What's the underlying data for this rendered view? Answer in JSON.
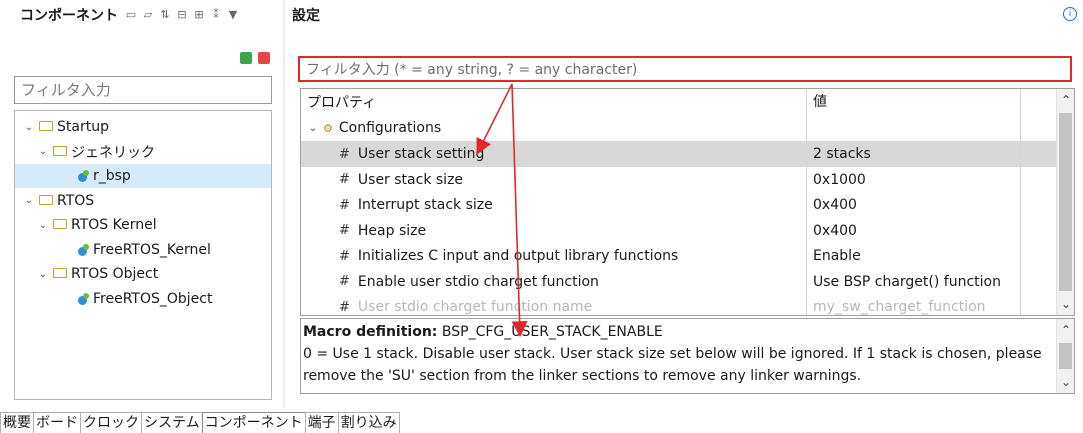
{
  "left_pane": {
    "title": "コンポーネント",
    "filter_placeholder": "フィルタ入力",
    "tree": [
      {
        "label": "Startup",
        "level": 0,
        "type": "folder",
        "expanded": true
      },
      {
        "label": "ジェネリック",
        "level": 1,
        "type": "folder",
        "expanded": true
      },
      {
        "label": "r_bsp",
        "level": 2,
        "type": "component",
        "selected": true
      },
      {
        "label": "RTOS",
        "level": 0,
        "type": "folder",
        "expanded": true
      },
      {
        "label": "RTOS Kernel",
        "level": 1,
        "type": "folder",
        "expanded": true
      },
      {
        "label": "FreeRTOS_Kernel",
        "level": 2,
        "type": "component"
      },
      {
        "label": "RTOS Object",
        "level": 1,
        "type": "folder",
        "expanded": true
      },
      {
        "label": "FreeRTOS_Object",
        "level": 2,
        "type": "component"
      }
    ]
  },
  "right_pane": {
    "title": "設定",
    "filter_placeholder": "フィルタ入力 (* = any string, ? = any character)",
    "grid": {
      "headers": {
        "property": "プロパティ",
        "value": "値"
      },
      "group": "Configurations",
      "rows": [
        {
          "property": "User stack setting",
          "value": "2 stacks",
          "selected": true
        },
        {
          "property": "User stack size",
          "value": "0x1000"
        },
        {
          "property": "Interrupt stack size",
          "value": "0x400"
        },
        {
          "property": "Heap size",
          "value": "0x400"
        },
        {
          "property": "Initializes C input and output library functions",
          "value": "Enable"
        },
        {
          "property": "Enable user stdio charget function",
          "value": "Use BSP charget() function"
        },
        {
          "property": "User stdio charget function name",
          "value": "my_sw_charget_function"
        }
      ]
    },
    "description": {
      "macro_label": "Macro definition:",
      "macro_name": "BSP_CFG_USER_STACK_ENABLE",
      "text": "0 = Use 1 stack. Disable user stack. User stack size set below will be ignored. If 1 stack is chosen, please remove the 'SU' section from the linker sections to remove any linker warnings."
    }
  },
  "bottom_tabs": [
    "概要",
    "ボード",
    "クロック",
    "システム",
    "コンポーネント",
    "端子",
    "割り込み"
  ],
  "active_tab": "コンポーネント",
  "colors": {
    "accent_red": "#e0282b",
    "selection_blue": "#d6ebfa",
    "row_selected": "#d8d8d8",
    "folder": "#c9a22d"
  }
}
